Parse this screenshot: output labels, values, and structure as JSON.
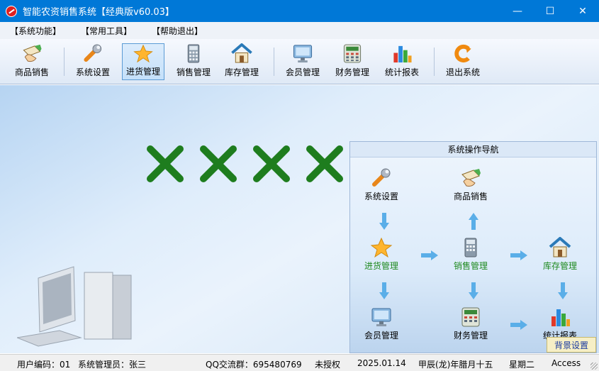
{
  "window": {
    "title": "智能农资销售系统【经典版v60.03】",
    "controls": [
      "—",
      "☐",
      "✕"
    ]
  },
  "menu": [
    "【系统功能】",
    "【常用工具】",
    "【帮助退出】"
  ],
  "toolbar": [
    {
      "label": "商品销售",
      "icon": "product-sale-icon"
    },
    {
      "label": "系统设置",
      "icon": "wrench-icon"
    },
    {
      "label": "进货管理",
      "icon": "star-icon",
      "active": true
    },
    {
      "label": "销售管理",
      "icon": "calculator-icon"
    },
    {
      "label": "库存管理",
      "icon": "house-icon"
    },
    {
      "label": "会员管理",
      "icon": "monitor-icon"
    },
    {
      "label": "财务管理",
      "icon": "cash-register-icon"
    },
    {
      "label": "统计报表",
      "icon": "bar-chart-icon"
    },
    {
      "label": "退出系统",
      "icon": "exit-icon"
    }
  ],
  "nav": {
    "title": "系统操作导航",
    "nodes": {
      "settings": "系统设置",
      "sale": "商品销售",
      "purchase": "进货管理",
      "sales_mgmt": "销售管理",
      "inventory": "库存管理",
      "member": "会员管理",
      "finance": "财务管理",
      "report": "统计报表"
    },
    "bg_button": "背景设置"
  },
  "status": {
    "user_code": "用户编码：01",
    "admin": "系统管理员：张三",
    "qq": "QQ交流群：695480769",
    "license": "未授权",
    "date": "2025.01.14",
    "lunar": "甲辰(龙)年腊月十五",
    "weekday": "星期二",
    "db": "Access"
  },
  "colors": {
    "titlebar": "#0078d7",
    "accent_green": "#1f8a1f",
    "cross_green": "#1e7d1e"
  }
}
